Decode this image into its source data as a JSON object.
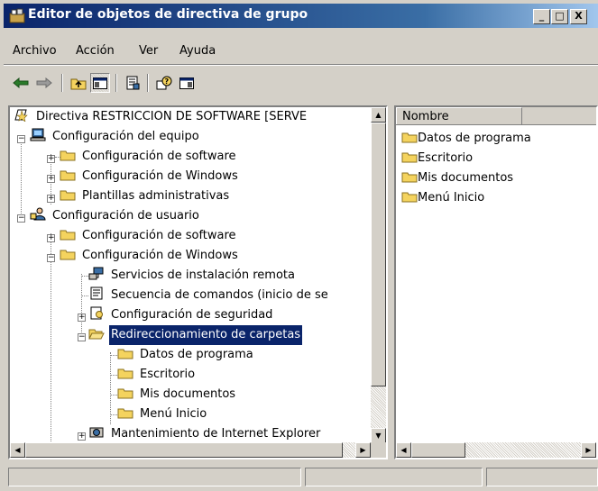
{
  "window": {
    "title": "Editor de objetos de directiva de grupo"
  },
  "menu": [
    "Archivo",
    "Acción",
    "Ver",
    "Ayuda"
  ],
  "title_buttons": {
    "minimize": "_",
    "maximize": "□",
    "close": "X"
  },
  "tree": {
    "root": "Directiva RESTRICCION DE SOFTWARE [SERVE",
    "items": [
      {
        "label": "Configuración del equipo",
        "icon": "computer-icon"
      },
      {
        "label": "Configuración de software",
        "icon": "folder-icon"
      },
      {
        "label": "Configuración de Windows",
        "icon": "folder-icon"
      },
      {
        "label": "Plantillas administrativas",
        "icon": "folder-icon"
      },
      {
        "label": "Configuración de usuario",
        "icon": "user-icon"
      },
      {
        "label": "Configuración de software",
        "icon": "folder-icon"
      },
      {
        "label": "Configuración de Windows",
        "icon": "folder-icon"
      },
      {
        "label": "Servicios de instalación remota",
        "icon": "network-icon"
      },
      {
        "label": "Secuencia de comandos (inicio de se",
        "icon": "script-icon"
      },
      {
        "label": "Configuración de seguridad",
        "icon": "security-icon"
      },
      {
        "label": "Redireccionamiento de carpetas",
        "icon": "open-folder-icon"
      },
      {
        "label": "Datos de programa",
        "icon": "folder-icon"
      },
      {
        "label": "Escritorio",
        "icon": "folder-icon"
      },
      {
        "label": "Mis documentos",
        "icon": "folder-icon"
      },
      {
        "label": "Menú Inicio",
        "icon": "folder-icon"
      },
      {
        "label": "Mantenimiento de Internet Explorer",
        "icon": "ie-icon"
      }
    ],
    "selected": "Redireccionamiento de carpetas"
  },
  "list": {
    "column_header": "Nombre",
    "items": [
      "Datos de programa",
      "Escritorio",
      "Mis documentos",
      "Menú Inicio"
    ]
  },
  "colors": {
    "selection": "#0a246a",
    "titlebar": "#0a246a",
    "folder": "#f4d35e"
  }
}
